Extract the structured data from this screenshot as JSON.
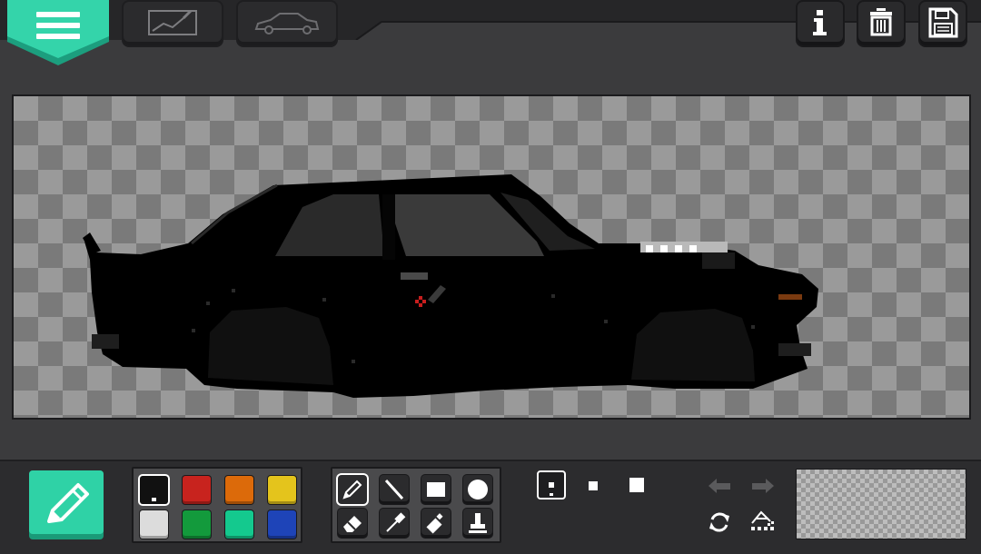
{
  "header": {
    "menu_icon": "hamburger-menu-icon",
    "tabs": [
      {
        "name": "tab-drawing",
        "icon": "sketch-canvas-icon"
      },
      {
        "name": "tab-car",
        "icon": "car-outline-icon"
      }
    ],
    "actions": [
      {
        "name": "info-button",
        "icon": "info-icon",
        "label": "i"
      },
      {
        "name": "delete-button",
        "icon": "trash-icon"
      },
      {
        "name": "save-button",
        "icon": "floppy-disk-icon"
      }
    ]
  },
  "canvas": {
    "subject": "car-sprite",
    "checker_colors": [
      "#9a9a9a",
      "#7a7a7a"
    ]
  },
  "toolbar": {
    "active_tool_icon": "pencil-icon",
    "accent_color": "#2fd2a6",
    "palette": [
      {
        "color": "#111111",
        "selected": true
      },
      {
        "color": "#c8231e",
        "selected": false
      },
      {
        "color": "#dc6a0a",
        "selected": false
      },
      {
        "color": "#e4c41c",
        "selected": false
      },
      {
        "color": "#dcdcdc",
        "selected": false
      },
      {
        "color": "#139a3c",
        "selected": false
      },
      {
        "color": "#14c98e",
        "selected": false
      },
      {
        "color": "#1e44b8",
        "selected": false
      }
    ],
    "tools": [
      {
        "name": "pencil-tool",
        "icon": "pencil-icon",
        "selected": true
      },
      {
        "name": "line-tool",
        "icon": "line-icon",
        "selected": false
      },
      {
        "name": "rectangle-tool",
        "icon": "rectangle-icon",
        "selected": false
      },
      {
        "name": "circle-tool",
        "icon": "circle-icon",
        "selected": false
      },
      {
        "name": "eraser-tool",
        "icon": "eraser-icon",
        "selected": false
      },
      {
        "name": "eyedropper-tool",
        "icon": "eyedropper-icon",
        "selected": false
      },
      {
        "name": "spray-tool",
        "icon": "spray-can-icon",
        "selected": false
      },
      {
        "name": "stamp-tool",
        "icon": "stamp-icon",
        "selected": false
      }
    ],
    "brush_sizes": [
      {
        "name": "brush-size-small",
        "selected": true
      },
      {
        "name": "brush-size-medium",
        "selected": false
      },
      {
        "name": "brush-size-large",
        "selected": false
      }
    ],
    "controls": [
      {
        "name": "undo-button",
        "icon": "undo-arrow-icon",
        "enabled": false
      },
      {
        "name": "redo-button",
        "icon": "redo-arrow-icon",
        "enabled": false
      },
      {
        "name": "rotate-button",
        "icon": "rotate-icon",
        "enabled": true
      },
      {
        "name": "fill-button",
        "icon": "paint-bucket-icon",
        "enabled": true
      }
    ],
    "preview": "canvas-preview-thumbnail"
  }
}
